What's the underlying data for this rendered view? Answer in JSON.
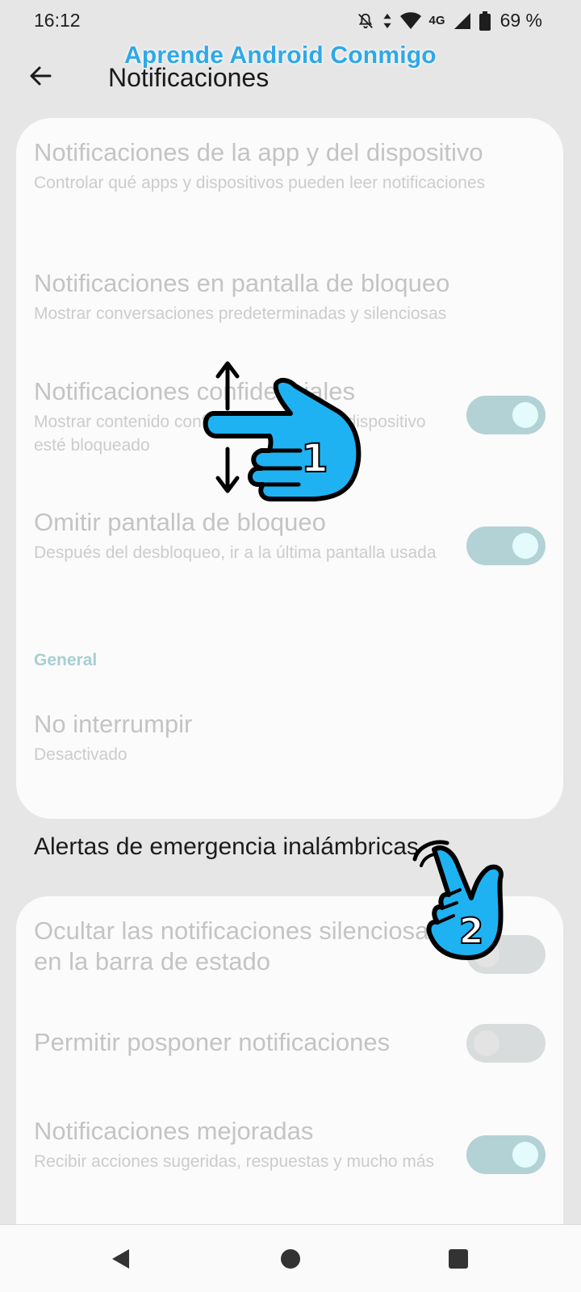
{
  "status_bar": {
    "time": "16:12",
    "network": "4G",
    "battery": "69 %"
  },
  "watermark": "Aprende Android Conmigo",
  "app_bar": {
    "title": "Notificaciones",
    "back_icon": "arrow-left-icon"
  },
  "card1": {
    "items": [
      {
        "title": "Notificaciones de la app y del dispositivo",
        "summary": "Controlar qué apps y dispositivos pueden leer notificaciones"
      },
      {
        "title": "Notificaciones en pantalla de bloqueo",
        "summary": "Mostrar conversaciones predeterminadas y silenciosas"
      },
      {
        "title": "Notificaciones confidenciales",
        "summary": "Mostrar contenido confidencial cuando el dispositivo esté bloqueado",
        "toggle": "on"
      },
      {
        "title": "Omitir pantalla de bloqueo",
        "summary": "Después del desbloqueo, ir a la última pantalla usada",
        "toggle": "on"
      }
    ],
    "section_header": "General",
    "dnd": {
      "title": "No interrumpir",
      "summary": "Desactivado"
    }
  },
  "emergency": {
    "title": "Alertas de emergencia inalámbricas"
  },
  "card2": {
    "items": [
      {
        "title": "Ocultar las notificaciones silenciosas en la barra de estado",
        "toggle": "off"
      },
      {
        "title": "Permitir posponer notificaciones",
        "toggle": "off"
      },
      {
        "title": "Notificaciones mejoradas",
        "summary": "Recibir acciones sugeridas, respuestas y mucho más",
        "toggle": "on"
      }
    ]
  },
  "annotations": {
    "step1": "1",
    "step2": "2"
  },
  "colors": {
    "hand_fill": "#1fb2f2",
    "watermark": "#2fa8e8",
    "toggle_on": "#b3d2d5"
  }
}
